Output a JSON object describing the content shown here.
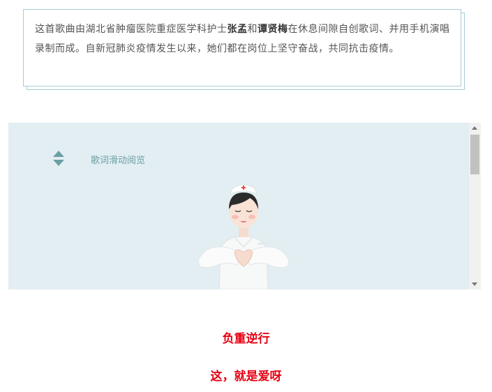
{
  "intro": {
    "part1": "这首歌曲由湖北省肿瘤医院重症医学科护士",
    "name1": "张孟",
    "and": "和",
    "name2": "谭贤梅",
    "part2": "在休息间隙自创歌词、并用手机演唱录制而成。自新冠肺炎疫情发生以来，她们都在岗位上坚守奋战，共同抗击疫情。"
  },
  "lyrics_panel": {
    "hint": "歌词滑动阅览"
  },
  "captions": {
    "line1": "负重逆行",
    "line2": "这，就是爱呀"
  },
  "colors": {
    "accent": "#6a9fa5",
    "panel_bg": "#e2eef2",
    "caption_red": "#e60012"
  },
  "icons": {
    "scroll_hint": "up-down-arrows-icon",
    "illustration": "nurse-heart-hands-illustration"
  }
}
